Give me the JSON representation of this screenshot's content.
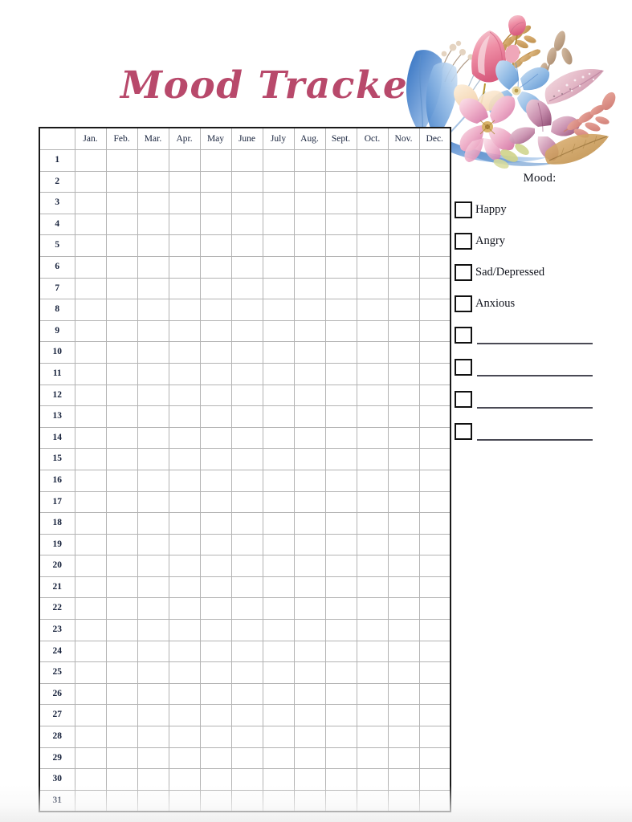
{
  "page": {
    "title": "Mood Tracker",
    "title_color": "#b8496b",
    "background_color": "#ffffff",
    "decoration": "watercolor-floral-bouquet"
  },
  "table": {
    "day_column_header": "",
    "months": [
      "Jan.",
      "Feb.",
      "Mar.",
      "Apr.",
      "May",
      "June",
      "July",
      "Aug.",
      "Sept.",
      "Oct.",
      "Nov.",
      "Dec."
    ],
    "days": [
      "1",
      "2",
      "3",
      "4",
      "5",
      "6",
      "7",
      "8",
      "9",
      "10",
      "11",
      "12",
      "13",
      "14",
      "15",
      "16",
      "17",
      "18",
      "19",
      "20",
      "21",
      "22",
      "23",
      "24",
      "25",
      "26",
      "27",
      "28",
      "29",
      "30",
      "31"
    ],
    "cells_empty": true,
    "border_color": "#1a1a1a",
    "grid_color": "#b3b3b3"
  },
  "legend": {
    "title": "Mood:",
    "items": [
      {
        "label": "Happy",
        "checked": false,
        "blank": false
      },
      {
        "label": "Angry",
        "checked": false,
        "blank": false
      },
      {
        "label": "Sad/Depressed",
        "checked": false,
        "blank": false
      },
      {
        "label": "Anxious",
        "checked": false,
        "blank": false
      },
      {
        "label": "",
        "checked": false,
        "blank": true
      },
      {
        "label": "",
        "checked": false,
        "blank": true
      },
      {
        "label": "",
        "checked": false,
        "blank": true
      },
      {
        "label": "",
        "checked": false,
        "blank": true
      }
    ]
  }
}
